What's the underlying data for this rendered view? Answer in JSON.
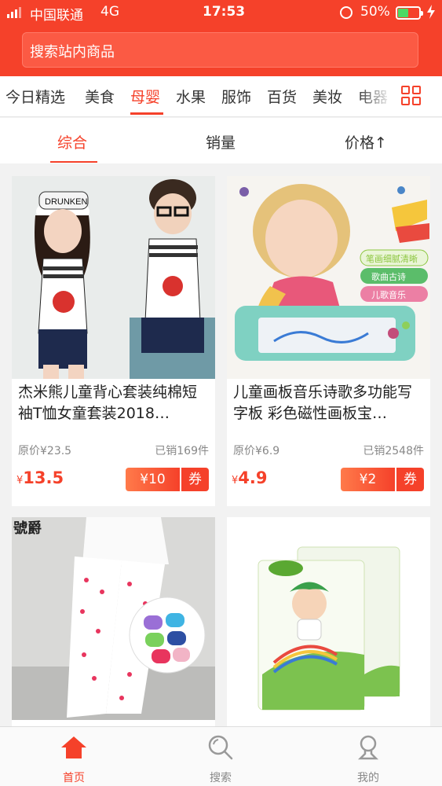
{
  "status_bar": {
    "carrier": "中国联通",
    "network": "4G",
    "time": "17:53",
    "battery": "50%",
    "battery_level": 0.5
  },
  "search": {
    "placeholder": "搜索站内商品"
  },
  "categories": [
    {
      "label": "今日精选"
    },
    {
      "label": "美食"
    },
    {
      "label": "母婴",
      "active": true
    },
    {
      "label": "水果"
    },
    {
      "label": "服饰"
    },
    {
      "label": "百货"
    },
    {
      "label": "美妆"
    },
    {
      "label": "电器"
    }
  ],
  "category_menu_icon": "grid-menu-icon",
  "sort_tabs": [
    {
      "label": "综合",
      "active": true
    },
    {
      "label": "销量"
    },
    {
      "label": "价格↑"
    }
  ],
  "products": [
    {
      "title": "杰米熊儿童背心套装纯棉短袖T恤女童套装2018…",
      "original_price": "原价¥23.5",
      "sold": "已销169件",
      "price_symbol": "¥",
      "price": "13.5",
      "coupon_amount": "¥10",
      "coupon_label": "券",
      "image_icon": "kids-clothing-image",
      "image_text": "DRUNKEN"
    },
    {
      "title": "儿童画板音乐诗歌多功能写字板 彩色磁性画板宝…",
      "original_price": "原价¥6.9",
      "sold": "已销2548件",
      "price_symbol": "¥",
      "price": "4.9",
      "coupon_amount": "¥2",
      "coupon_label": "券",
      "image_icon": "drawing-board-image",
      "image_badges": [
        "笔画细腻清晰",
        "歌曲古诗",
        "儿歌音乐"
      ]
    },
    {
      "image_icon": "kids-tights-image",
      "image_text": "號爵"
    },
    {
      "image_icon": "diapers-image"
    }
  ],
  "tabbar": [
    {
      "label": "首页",
      "icon": "home-icon",
      "active": true
    },
    {
      "label": "搜索",
      "icon": "search-icon"
    },
    {
      "label": "我的",
      "icon": "user-icon"
    }
  ],
  "colors": {
    "brand": "#f5412a",
    "text": "#333333",
    "muted": "#888888",
    "battery": "#4cd964"
  }
}
